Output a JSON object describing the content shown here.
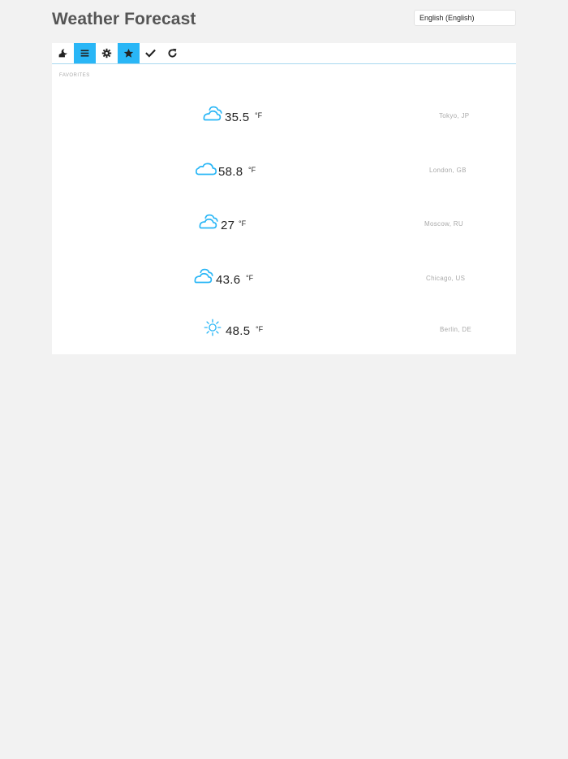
{
  "app": {
    "title": "Weather Forecast"
  },
  "language": {
    "selected": "English (English)"
  },
  "toolbar": {
    "buttons": [
      {
        "icon": "weather-night-icon",
        "active": false
      },
      {
        "icon": "list-icon",
        "active": true
      },
      {
        "icon": "gear-icon",
        "active": false
      },
      {
        "icon": "star-icon",
        "active": true
      },
      {
        "icon": "check-icon",
        "active": false
      },
      {
        "icon": "refresh-icon",
        "active": false
      }
    ]
  },
  "favorites": {
    "label": "FAVORITES",
    "items": [
      {
        "icon": "partly-cloudy-icon",
        "temp": "35.5",
        "unit": "°F",
        "city": "Tokyo, JP"
      },
      {
        "icon": "cloud-icon",
        "temp": "58.8",
        "unit": "°F",
        "city": "London, GB"
      },
      {
        "icon": "partly-cloudy-icon",
        "temp": "27",
        "unit": "°F",
        "city": "Moscow, RU"
      },
      {
        "icon": "partly-cloudy-icon",
        "temp": "43.6",
        "unit": "°F",
        "city": "Chicago, US"
      },
      {
        "icon": "sun-icon",
        "temp": "48.5",
        "unit": "°F",
        "city": "Berlin, DE"
      }
    ]
  },
  "colors": {
    "accent": "#29b6f6",
    "icon": "#29b6f6"
  }
}
